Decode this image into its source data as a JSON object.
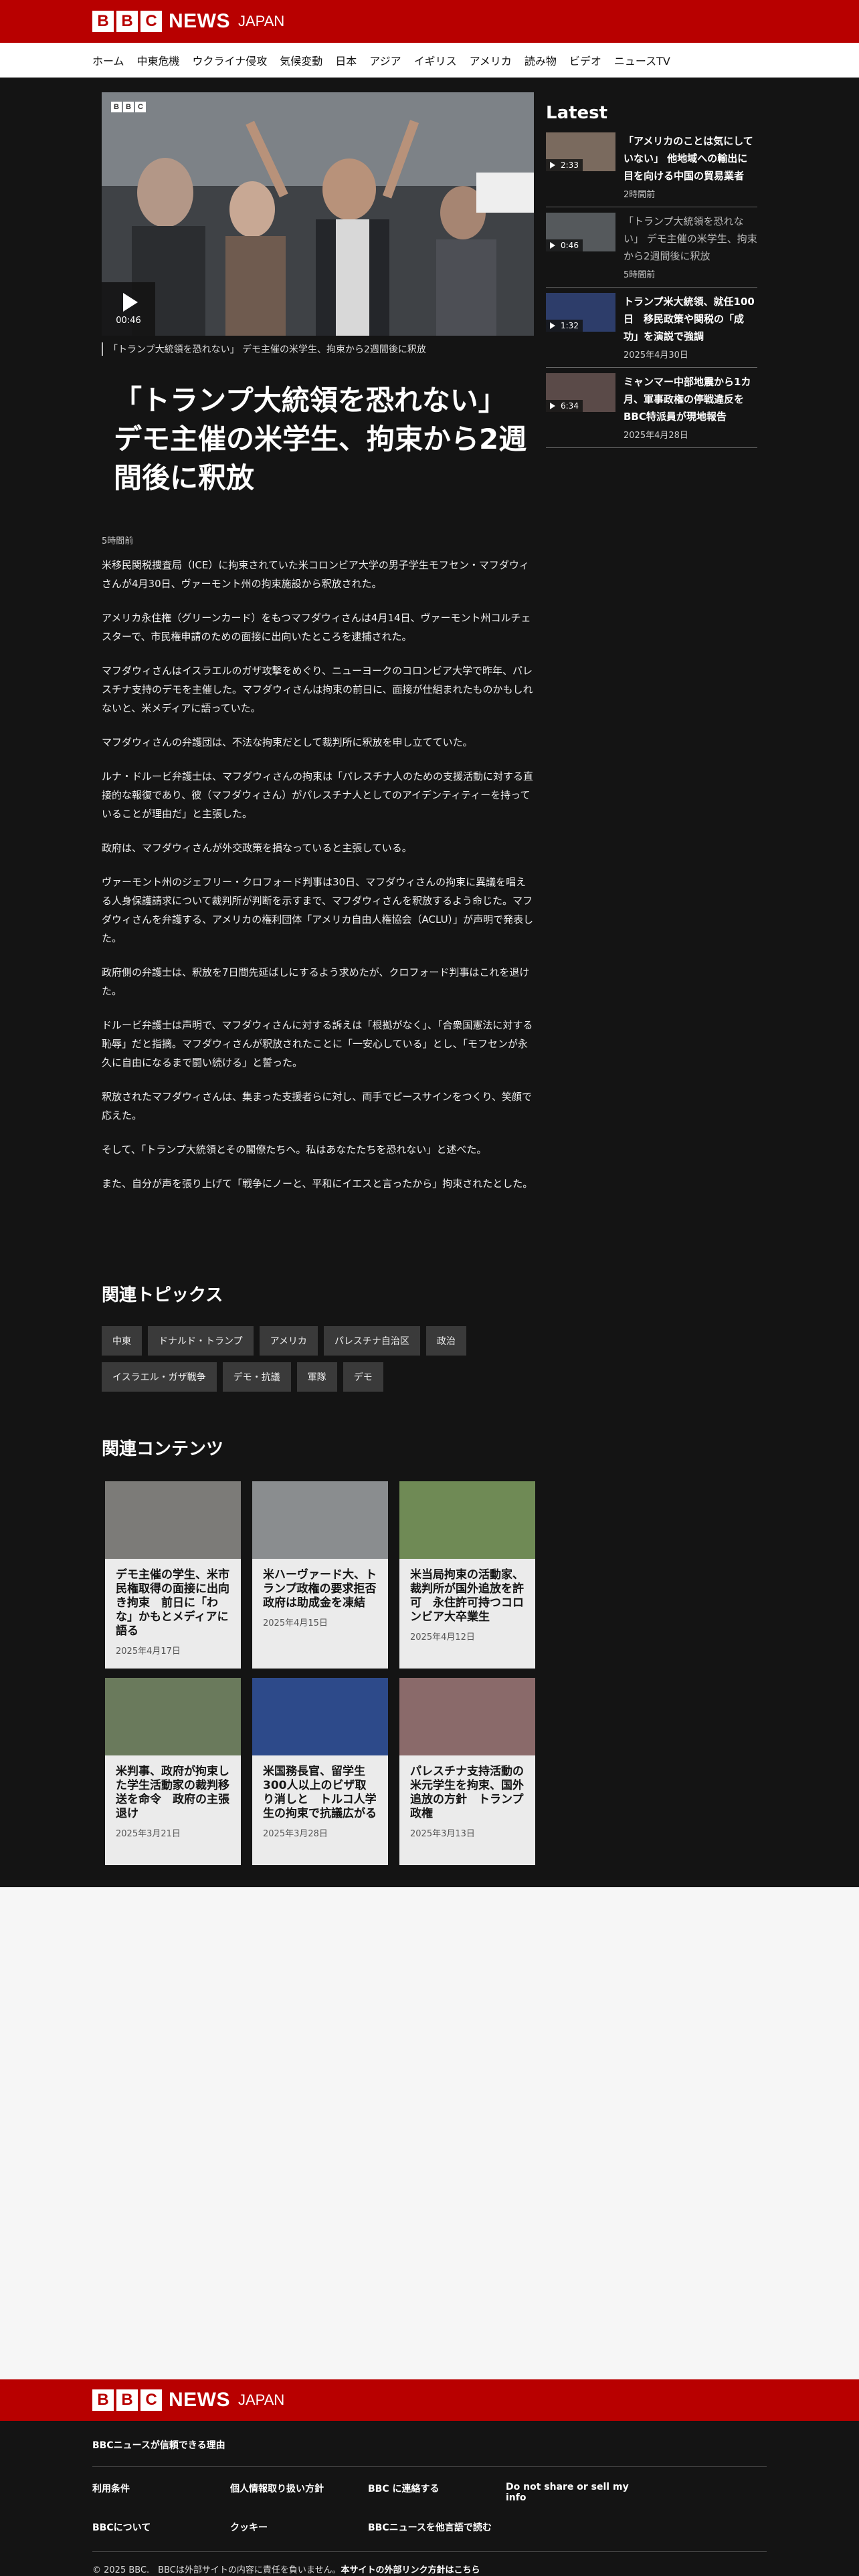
{
  "brand": {
    "bbc": [
      "B",
      "B",
      "C"
    ],
    "news": "NEWS",
    "japan": "JAPAN"
  },
  "nav": [
    "ホーム",
    "中東危機",
    "ウクライナ侵攻",
    "気候変動",
    "日本",
    "アジア",
    "イギリス",
    "アメリカ",
    "読み物",
    "ビデオ",
    "ニュースTV"
  ],
  "article": {
    "video_duration": "00:46",
    "caption": "「トランプ大統領を恐れない」 デモ主催の米学生、拘束から2週間後に釈放",
    "headline": "「トランプ大統領を恐れない」デモ主催の米学生、拘束から2週間後に釈放",
    "timestamp": "5時間前",
    "paragraphs": [
      "米移民関税捜査局（ICE）に拘束されていた米コロンビア大学の男子学生モフセン・マフダウィさんが4月30日、ヴァーモント州の拘束施設から釈放された。",
      "アメリカ永住権（グリーンカード）をもつマフダウィさんは4月14日、ヴァーモント州コルチェスターで、市民権申請のための面接に出向いたところを逮捕された。",
      "マフダウィさんはイスラエルのガザ攻撃をめぐり、ニューヨークのコロンビア大学で昨年、パレスチナ支持のデモを主催した。マフダウィさんは拘束の前日に、面接が仕組まれたものかもしれないと、米メディアに語っていた。",
      "マフダウィさんの弁護団は、不法な拘束だとして裁判所に釈放を申し立てていた。",
      "ルナ・ドルービ弁護士は、マフダウィさんの拘束は「パレスチナ人のための支援活動に対する直接的な報復であり、彼（マフダウィさん）がパレスチナ人としてのアイデンティティーを持っていることが理由だ」と主張した。",
      "政府は、マフダウィさんが外交政策を損なっていると主張している。",
      "ヴァーモント州のジェフリー・クロフォード判事は30日、マフダウィさんの拘束に異議を唱える人身保護請求について裁判所が判断を示すまで、マフダウィさんを釈放するよう命じた。マフダウィさんを弁護する、アメリカの権利団体「アメリカ自由人権協会（ACLU）」が声明で発表した。",
      "政府側の弁護士は、釈放を7日間先延ばしにするよう求めたが、クロフォード判事はこれを退けた。",
      "ドルービ弁護士は声明で、マフダウィさんに対する訴えは「根拠がなく」、「合衆国憲法に対する恥辱」だと指摘。マフダウィさんが釈放されたことに「一安心している」とし、「モフセンが永久に自由になるまで闘い続ける」と誓った。",
      "釈放されたマフダウィさんは、集まった支援者らに対し、両手でピースサインをつくり、笑顔で応えた。",
      "そして、「トランプ大統領とその閣僚たちへ。私はあなたたちを恐れない」と述べた。",
      "また、自分が声を張り上げて「戦争にノーと、平和にイエスと言ったから」拘束されたとした。"
    ]
  },
  "latest": {
    "title": "Latest",
    "items": [
      {
        "duration": "2:33",
        "headline": "「アメリカのことは気にしていない」 他地域への輸出に目を向ける中国の貿易業者",
        "date": "2時間前",
        "read": false
      },
      {
        "duration": "0:46",
        "headline": "「トランプ大統領を恐れない」 デモ主催の米学生、拘束から2週間後に釈放",
        "date": "5時間前",
        "read": true
      },
      {
        "duration": "1:32",
        "headline": "トランプ米大統領、就任100日　移民政策や関税の「成功」を演説で強調",
        "date": "2025年4月30日",
        "read": false
      },
      {
        "duration": "6:34",
        "headline": "ミャンマー中部地震から1カ月、軍事政権の停戦違反をBBC特派員が現地報告",
        "date": "2025年4月28日",
        "read": false
      }
    ]
  },
  "topics": {
    "title": "関連トピックス",
    "chips": [
      "中東",
      "ドナルド・トランプ",
      "アメリカ",
      "パレスチナ自治区",
      "政治",
      "イスラエル・ガザ戦争",
      "デモ・抗議",
      "軍隊",
      "デモ"
    ]
  },
  "related": {
    "title": "関連コンテンツ",
    "cards": [
      {
        "title": "デモ主催の学生、米市民権取得の面接に出向き拘束　前日に「わな」かもとメディアに語る",
        "date": "2025年4月17日"
      },
      {
        "title": "米ハーヴァード大、トランプ政権の要求拒否　政府は助成金を凍結",
        "date": "2025年4月15日"
      },
      {
        "title": "米当局拘束の活動家、裁判所が国外追放を許可　永住許可持つコロンビア大卒業生",
        "date": "2025年4月12日"
      },
      {
        "title": "米判事、政府が拘束した学生活動家の裁判移送を命令　政府の主張退け",
        "date": "2025年3月21日"
      },
      {
        "title": "米国務長官、留学生300人以上のビザ取り消しと　トルコ人学生の拘束で抗議広がる",
        "date": "2025年3月28日"
      },
      {
        "title": "パレスチナ支持活動の米元学生を拘束、国外追放の方針　トランプ政権",
        "date": "2025年3月13日"
      }
    ]
  },
  "footer": {
    "trust": "BBCニュースが信頼できる理由",
    "links": [
      "利用条件",
      "個人情報取り扱い方針",
      "BBC に連絡する",
      "Do not share or sell my info",
      "BBCについて",
      "クッキー",
      "BBCニュースを他言語で読む"
    ],
    "copyright": "© 2025 BBC.　BBCは外部サイトの内容に責任を負いません。",
    "external_policy": "本サイトの外部リンク方針はこちら"
  }
}
